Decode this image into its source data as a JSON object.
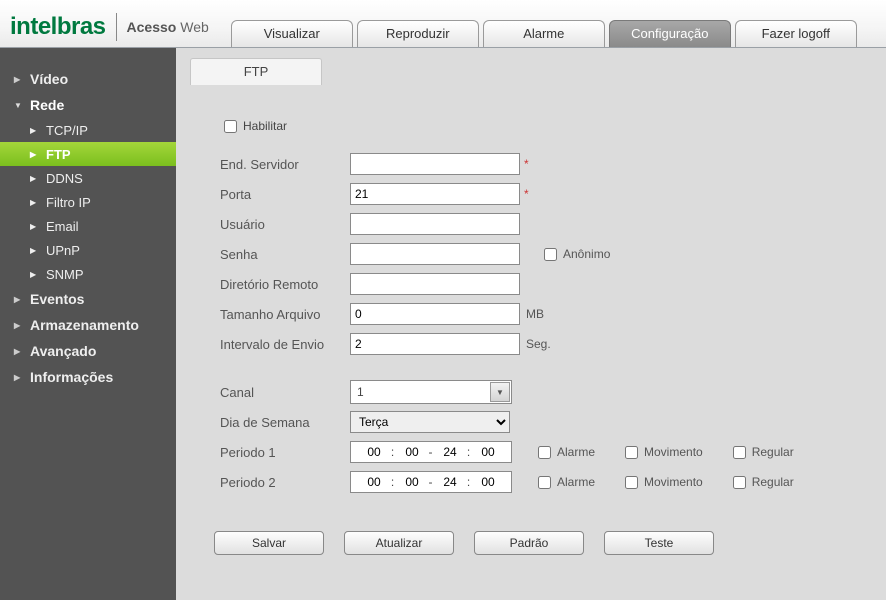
{
  "logo": {
    "brand": "intelbras",
    "sub1": "Acesso",
    "sub2": "Web"
  },
  "mainTabs": {
    "visualizar": "Visualizar",
    "reproduzir": "Reproduzir",
    "alarme": "Alarme",
    "configuracao": "Configuração",
    "logoff": "Fazer logoff"
  },
  "sidebar": {
    "video": "Vídeo",
    "rede": "Rede",
    "rede_items": {
      "tcpip": "TCP/IP",
      "ftp": "FTP",
      "ddns": "DDNS",
      "filtroip": "Filtro IP",
      "email": "Email",
      "upnp": "UPnP",
      "snmp": "SNMP"
    },
    "eventos": "Eventos",
    "armazenamento": "Armazenamento",
    "avancado": "Avançado",
    "informacoes": "Informações"
  },
  "subTab": "FTP",
  "form": {
    "habilitar": "Habilitar",
    "end_servidor": "End. Servidor",
    "end_servidor_val": "",
    "porta": "Porta",
    "porta_val": "21",
    "usuario": "Usuário",
    "usuario_val": "",
    "senha": "Senha",
    "senha_val": "",
    "anonimo": "Anônimo",
    "dir_remoto": "Diretório Remoto",
    "dir_remoto_val": "",
    "tamanho_arquivo": "Tamanho Arquivo",
    "tamanho_arquivo_val": "0",
    "tamanho_unit": "MB",
    "intervalo": "Intervalo de Envio",
    "intervalo_val": "2",
    "intervalo_unit": "Seg.",
    "canal": "Canal",
    "canal_val": "1",
    "dia": "Dia de Semana",
    "dia_val": "Terça",
    "periodo1": "Periodo 1",
    "periodo2": "Periodo 2",
    "p1_h1": "00",
    "p1_m1": "00",
    "p1_h2": "24",
    "p1_m2": "00",
    "p2_h1": "00",
    "p2_m1": "00",
    "p2_h2": "24",
    "p2_m2": "00",
    "chk_alarme": "Alarme",
    "chk_mov": "Movimento",
    "chk_reg": "Regular"
  },
  "buttons": {
    "salvar": "Salvar",
    "atualizar": "Atualizar",
    "padrao": "Padrão",
    "teste": "Teste"
  }
}
